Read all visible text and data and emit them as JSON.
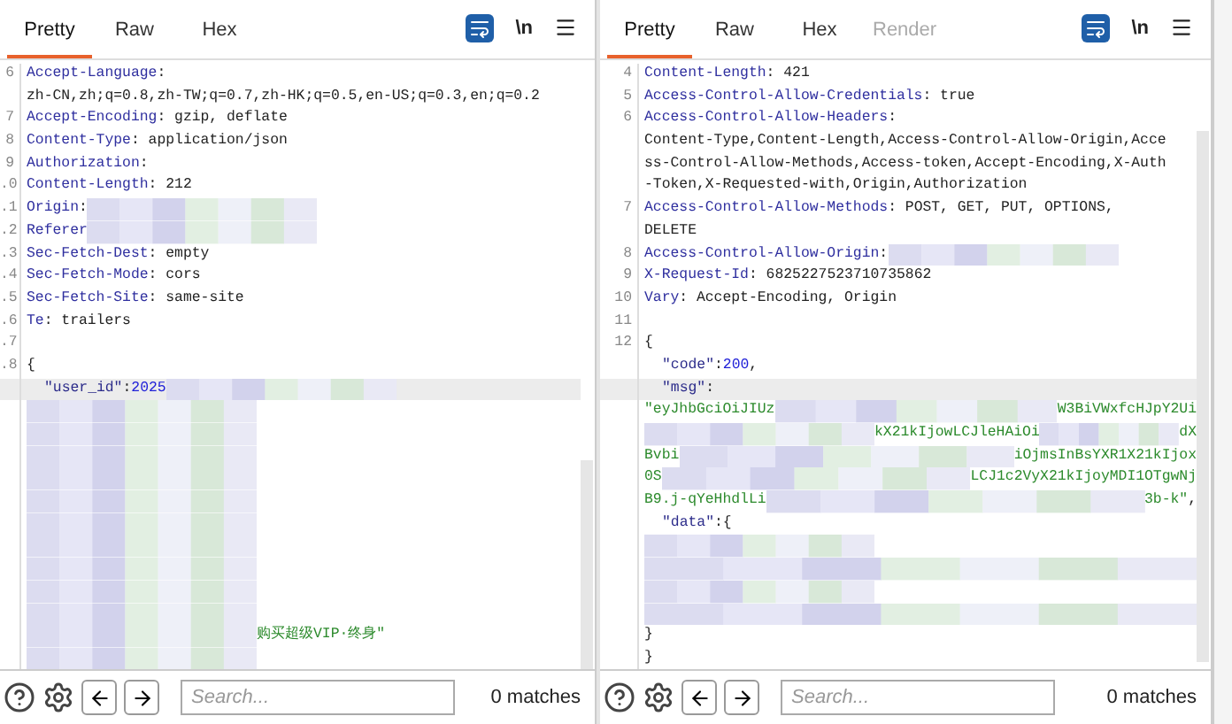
{
  "panes": [
    {
      "tabs": [
        {
          "label": "Pretty",
          "selected": true,
          "disabled": false
        },
        {
          "label": "Raw",
          "selected": false,
          "disabled": false
        },
        {
          "label": "Hex",
          "selected": false,
          "disabled": false
        }
      ],
      "wrap_on": true,
      "newline_toggle": "\\n",
      "rows": [
        {
          "num": "6",
          "highlighted": false,
          "parts": [
            {
              "kind": "key",
              "text": "Accept-Language"
            },
            {
              "kind": "text",
              "text": ":"
            }
          ]
        },
        {
          "highlighted": false,
          "parts": [
            {
              "kind": "text",
              "text": "zh-CN,zh;q=0.8,zh-TW;q=0.7,zh-HK;q=0.5,en-US;q=0.3,en;q=0.2"
            }
          ]
        },
        {
          "num": "7",
          "highlighted": false,
          "parts": [
            {
              "kind": "key",
              "text": "Accept-Encoding"
            },
            {
              "kind": "text",
              "text": ": gzip, deflate"
            }
          ]
        },
        {
          "num": "8",
          "highlighted": false,
          "parts": [
            {
              "kind": "key",
              "text": "Content-Type"
            },
            {
              "kind": "text",
              "text": ": application/json"
            }
          ]
        },
        {
          "num": "9",
          "highlighted": false,
          "parts": [
            {
              "kind": "key",
              "text": "Authorization"
            },
            {
              "kind": "text",
              "text": ":"
            }
          ]
        },
        {
          "num": ".0",
          "highlighted": false,
          "parts": [
            {
              "kind": "key",
              "text": "Content-Length"
            },
            {
              "kind": "text",
              "text": ": 212"
            }
          ]
        },
        {
          "num": ".1",
          "highlighted": false,
          "parts": [
            {
              "kind": "key",
              "text": "Origin"
            },
            {
              "kind": "text",
              "text": ":"
            },
            {
              "kind": "mosaic"
            }
          ]
        },
        {
          "num": ".2",
          "highlighted": false,
          "parts": [
            {
              "kind": "key",
              "text": "Referer"
            },
            {
              "kind": "mosaic"
            }
          ]
        },
        {
          "num": ".3",
          "highlighted": false,
          "parts": [
            {
              "kind": "key",
              "text": "Sec-Fetch-Dest"
            },
            {
              "kind": "text",
              "text": ": empty"
            }
          ]
        },
        {
          "num": ".4",
          "highlighted": false,
          "parts": [
            {
              "kind": "key",
              "text": "Sec-Fetch-Mode"
            },
            {
              "kind": "text",
              "text": ": cors"
            }
          ]
        },
        {
          "num": ".5",
          "highlighted": false,
          "parts": [
            {
              "kind": "key",
              "text": "Sec-Fetch-Site"
            },
            {
              "kind": "text",
              "text": ": same-site"
            }
          ]
        },
        {
          "num": ".6",
          "highlighted": false,
          "parts": [
            {
              "kind": "key",
              "text": "Te"
            },
            {
              "kind": "text",
              "text": ": trailers"
            }
          ]
        },
        {
          "num": ".7",
          "highlighted": false,
          "parts": []
        },
        {
          "num": ".8",
          "highlighted": false,
          "parts": [
            {
              "kind": "text",
              "text": "{"
            }
          ]
        },
        {
          "highlighted": true,
          "parts": [
            {
              "kind": "jkey",
              "text": "\"user_id\""
            },
            {
              "kind": "text",
              "text": ":"
            },
            {
              "kind": "number",
              "text": "2025"
            },
            {
              "kind": "mosaic"
            }
          ]
        },
        {
          "highlighted": false,
          "parts": [
            {
              "kind": "mosaic"
            }
          ]
        },
        {
          "highlighted": false,
          "parts": [
            {
              "kind": "mosaic"
            }
          ]
        },
        {
          "highlighted": false,
          "parts": [
            {
              "kind": "mosaic"
            }
          ]
        },
        {
          "highlighted": false,
          "parts": [
            {
              "kind": "mosaic"
            }
          ]
        },
        {
          "highlighted": false,
          "parts": [
            {
              "kind": "mosaic"
            }
          ]
        },
        {
          "highlighted": false,
          "parts": [
            {
              "kind": "mosaic"
            }
          ]
        },
        {
          "highlighted": false,
          "parts": [
            {
              "kind": "mosaic"
            }
          ]
        },
        {
          "highlighted": false,
          "parts": [
            {
              "kind": "mosaic"
            }
          ]
        },
        {
          "highlighted": false,
          "parts": [
            {
              "kind": "mosaic"
            }
          ]
        },
        {
          "highlighted": false,
          "parts": [
            {
              "kind": "mosaic"
            }
          ]
        },
        {
          "highlighted": false,
          "parts": [
            {
              "kind": "mosaic"
            },
            {
              "kind": "string",
              "text": "购买超级VIP·终身\""
            }
          ]
        },
        {
          "highlighted": false,
          "parts": [
            {
              "kind": "mosaic"
            }
          ]
        }
      ],
      "search": {
        "placeholder": "Search..."
      },
      "matches": "0 matches"
    },
    {
      "tabs": [
        {
          "label": "Pretty",
          "selected": true,
          "disabled": false
        },
        {
          "label": "Raw",
          "selected": false,
          "disabled": false
        },
        {
          "label": "Hex",
          "selected": false,
          "disabled": false
        },
        {
          "label": "Render",
          "selected": false,
          "disabled": true
        }
      ],
      "wrap_on": true,
      "newline_toggle": "\\n",
      "rows": [
        {
          "num": "4",
          "highlighted": false,
          "parts": [
            {
              "kind": "key",
              "text": "Content-Length"
            },
            {
              "kind": "text",
              "text": ": 421"
            }
          ]
        },
        {
          "num": "5",
          "highlighted": false,
          "parts": [
            {
              "kind": "key",
              "text": "Access-Control-Allow-Credentials"
            },
            {
              "kind": "text",
              "text": ": true"
            }
          ]
        },
        {
          "num": "6",
          "highlighted": false,
          "parts": [
            {
              "kind": "key",
              "text": "Access-Control-Allow-Headers"
            },
            {
              "kind": "text",
              "text": ":"
            }
          ]
        },
        {
          "highlighted": false,
          "parts": [
            {
              "kind": "text",
              "text": "Content-Type,Content-Length,Access-Control-Allow-Origin,Acce"
            }
          ]
        },
        {
          "highlighted": false,
          "parts": [
            {
              "kind": "text",
              "text": "ss-Control-Allow-Methods,Access-token,Accept-Encoding,X-Auth"
            }
          ]
        },
        {
          "highlighted": false,
          "parts": [
            {
              "kind": "text",
              "text": "-Token,X-Requested-with,Origin,Authorization"
            }
          ]
        },
        {
          "num": "7",
          "highlighted": false,
          "parts": [
            {
              "kind": "key",
              "text": "Access-Control-Allow-Methods"
            },
            {
              "kind": "text",
              "text": ": POST, GET, PUT, OPTIONS,"
            }
          ]
        },
        {
          "highlighted": false,
          "parts": [
            {
              "kind": "text",
              "text": "DELETE"
            }
          ]
        },
        {
          "num": "8",
          "highlighted": false,
          "parts": [
            {
              "kind": "key",
              "text": "Access-Control-Allow-Origin"
            },
            {
              "kind": "text",
              "text": ":"
            },
            {
              "kind": "mosaic"
            }
          ]
        },
        {
          "num": "9",
          "highlighted": false,
          "parts": [
            {
              "kind": "key",
              "text": "X-Request-Id"
            },
            {
              "kind": "text",
              "text": ": 6825227523710735862"
            }
          ]
        },
        {
          "num": "10",
          "highlighted": false,
          "parts": [
            {
              "kind": "key",
              "text": "Vary"
            },
            {
              "kind": "text",
              "text": ": Accept-Encoding, Origin"
            }
          ]
        },
        {
          "num": "11",
          "highlighted": false,
          "parts": []
        },
        {
          "num": "12",
          "highlighted": false,
          "parts": [
            {
              "kind": "text",
              "text": "{"
            }
          ]
        },
        {
          "highlighted": false,
          "parts": [
            {
              "kind": "jkey",
              "text": "\"code\""
            },
            {
              "kind": "text",
              "text": ":"
            },
            {
              "kind": "number",
              "text": "200"
            },
            {
              "kind": "text",
              "text": ","
            }
          ]
        },
        {
          "highlighted": true,
          "parts": [
            {
              "kind": "jkey",
              "text": "\"msg\""
            },
            {
              "kind": "text",
              "text": ":"
            }
          ]
        },
        {
          "highlighted": false,
          "parts": [
            {
              "kind": "string",
              "text": "\"eyJhbGciOiJIUz"
            },
            {
              "kind": "mosaic_wide"
            },
            {
              "kind": "string",
              "text": "W3BiVWxfcHJpY2Ui"
            }
          ]
        },
        {
          "highlighted": false,
          "parts": [
            {
              "kind": "mosaic"
            },
            {
              "kind": "string",
              "text": "kX21kIjowLCJleHAiOi"
            },
            {
              "kind": "mosaic_wide"
            },
            {
              "kind": "string",
              "text": "dX"
            }
          ]
        },
        {
          "highlighted": false,
          "parts": [
            {
              "kind": "string",
              "text": "Bvbi"
            },
            {
              "kind": "mosaic_wide"
            },
            {
              "kind": "string",
              "text": "iOjmsInBsYXR1X21kIjox"
            }
          ]
        },
        {
          "highlighted": false,
          "parts": [
            {
              "kind": "string",
              "text": "0S"
            },
            {
              "kind": "mosaic_wide"
            },
            {
              "kind": "string",
              "text": "LCJ1c2VyX21kIjoyMDI1OTgwNj"
            }
          ]
        },
        {
          "highlighted": false,
          "parts": [
            {
              "kind": "string",
              "text": "B9.j-qYeHhdlLi"
            },
            {
              "kind": "mosaic_wide"
            },
            {
              "kind": "string",
              "text": "3b-k\""
            },
            {
              "kind": "text",
              "text": ","
            }
          ]
        },
        {
          "highlighted": false,
          "parts": [
            {
              "kind": "jkey",
              "text": "\"data\""
            },
            {
              "kind": "text",
              "text": ":{"
            }
          ]
        },
        {
          "highlighted": false,
          "parts": [
            {
              "kind": "mosaic"
            }
          ]
        },
        {
          "highlighted": false,
          "parts": [
            {
              "kind": "mosaic_wide"
            }
          ]
        },
        {
          "highlighted": false,
          "parts": [
            {
              "kind": "mosaic"
            }
          ]
        },
        {
          "highlighted": false,
          "parts": [
            {
              "kind": "mosaic_wide"
            }
          ]
        },
        {
          "highlighted": false,
          "parts": [
            {
              "kind": "text",
              "text": "}"
            }
          ]
        },
        {
          "highlighted": false,
          "parts": [
            {
              "kind": "text",
              "text": "}"
            }
          ]
        }
      ],
      "search": {
        "placeholder": "Search..."
      },
      "matches": "0 matches"
    }
  ]
}
